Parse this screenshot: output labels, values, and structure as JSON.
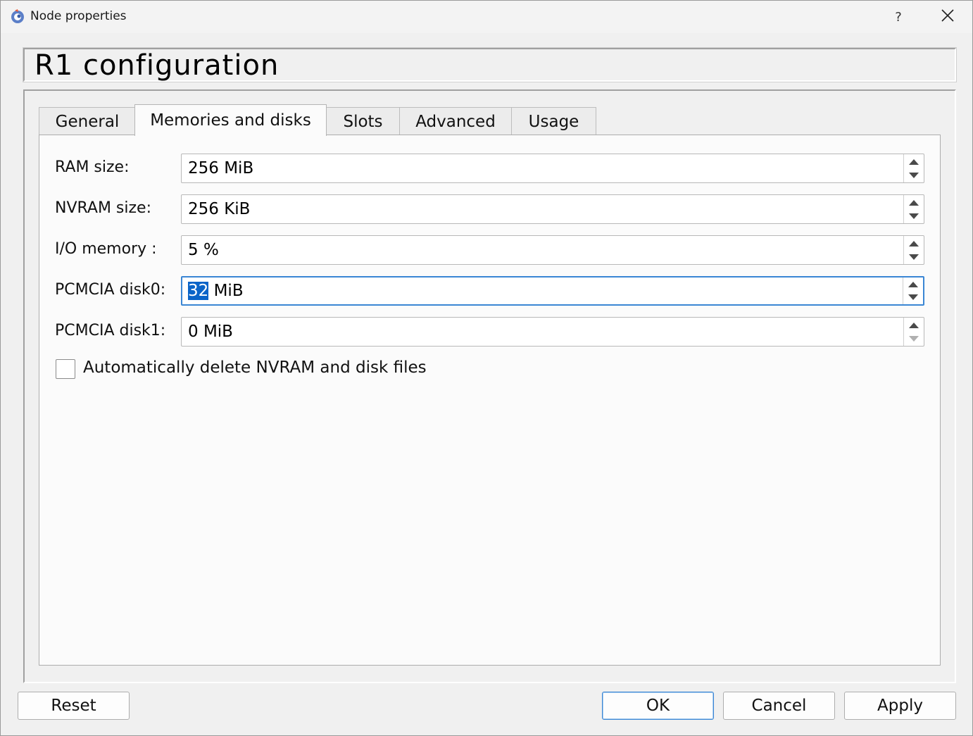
{
  "window": {
    "title": "Node properties",
    "help_label": "?"
  },
  "header": {
    "title": "R1 configuration"
  },
  "tabs": [
    {
      "label": "General",
      "active": false
    },
    {
      "label": "Memories and disks",
      "active": true
    },
    {
      "label": "Slots",
      "active": false
    },
    {
      "label": "Advanced",
      "active": false
    },
    {
      "label": "Usage",
      "active": false
    }
  ],
  "fields": [
    {
      "label": "RAM size:",
      "value": "256 MiB"
    },
    {
      "label": "NVRAM size:",
      "value": "256 KiB"
    },
    {
      "label": "I/O memory :",
      "value": "5 %"
    },
    {
      "label": "PCMCIA disk0:",
      "value_selected": "32",
      "value_rest": " MiB",
      "focused": true
    },
    {
      "label": "PCMCIA disk1:",
      "value": "0 MiB"
    }
  ],
  "checkbox": {
    "label": "Automatically delete NVRAM and disk files",
    "checked": false
  },
  "buttons": {
    "reset": "Reset",
    "ok": "OK",
    "cancel": "Cancel",
    "apply": "Apply"
  },
  "colors": {
    "focus": "#3a86d4",
    "selection": "#0a64c8"
  },
  "icons": {
    "app": "gns3-app-icon",
    "close": "close-icon",
    "spin_up": "arrow-up-icon",
    "spin_down": "arrow-down-icon"
  }
}
